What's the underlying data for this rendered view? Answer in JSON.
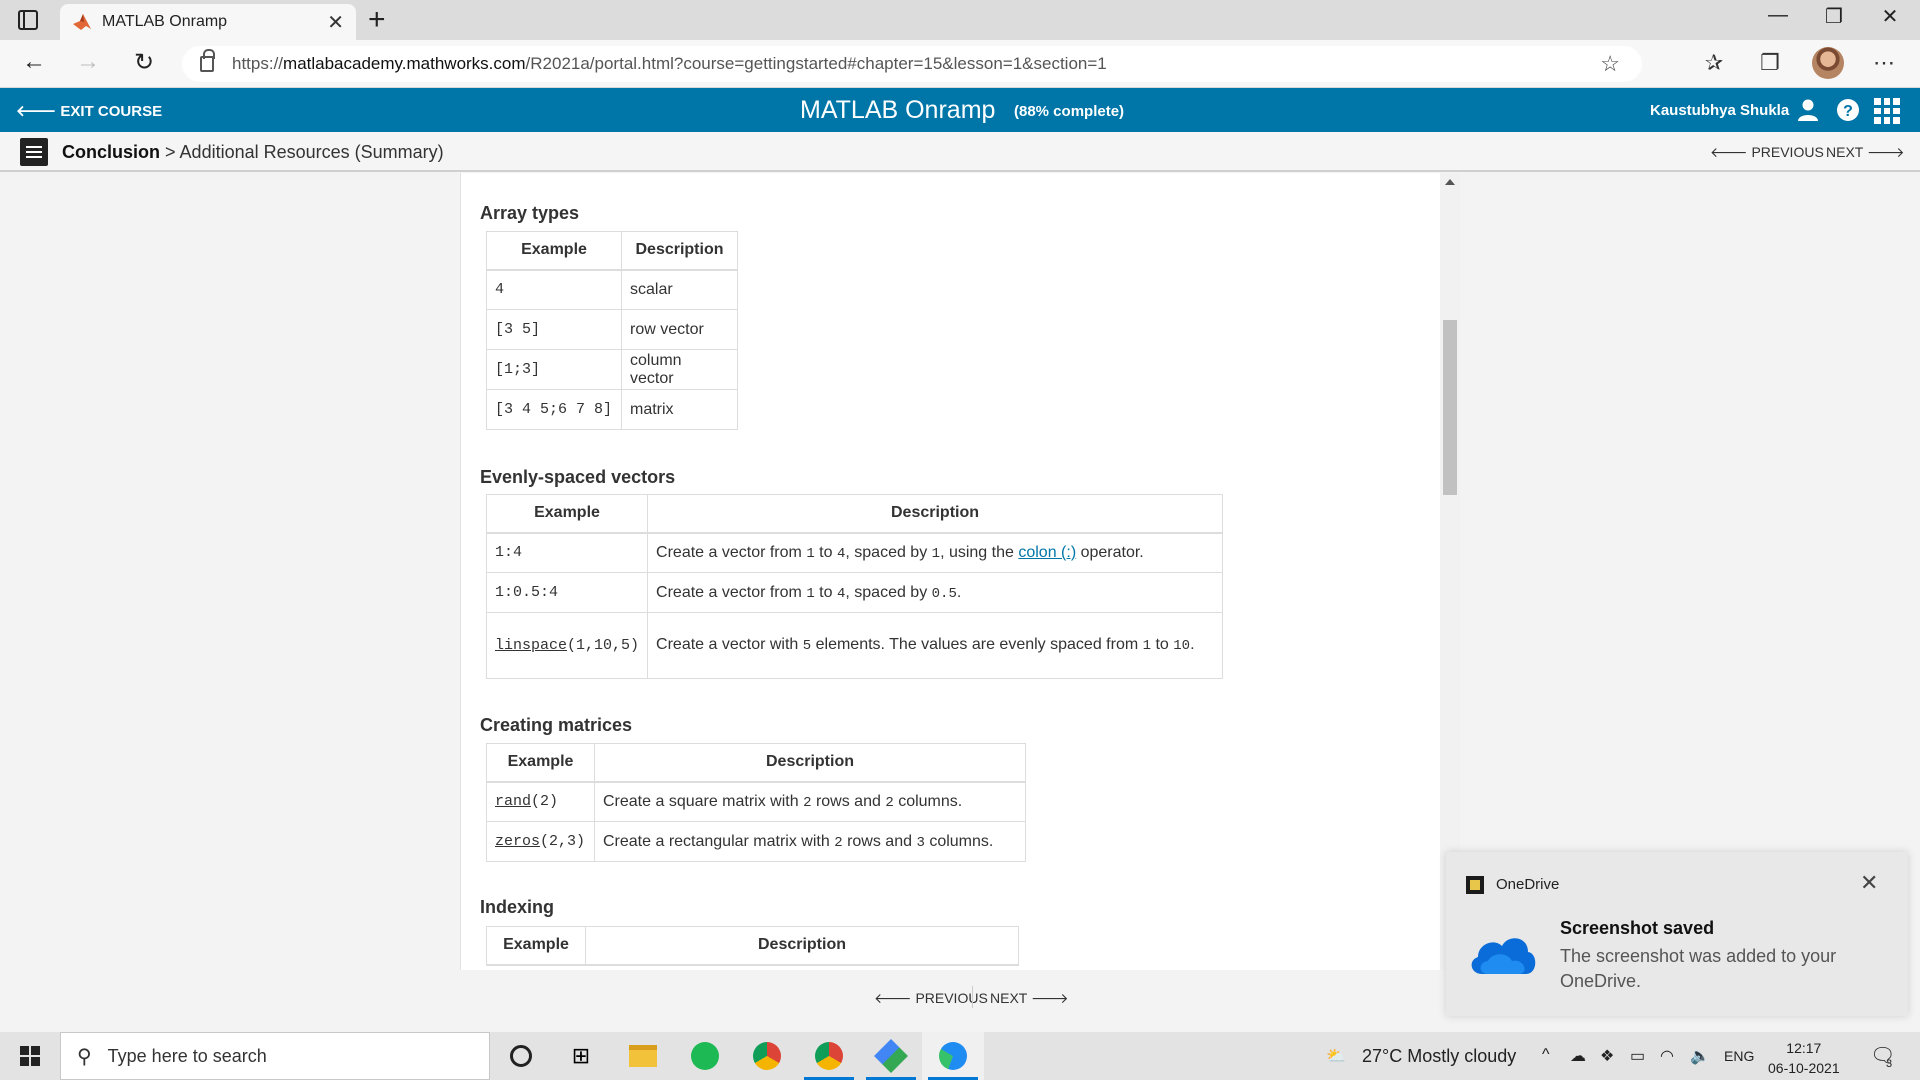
{
  "browser": {
    "tab_title": "MATLAB Onramp",
    "tab_close": "✕",
    "new_tab": "+",
    "url_prefix": "https://",
    "url_host": "matlabacademy.mathworks.com",
    "url_path": "/R2021a/portal.html?course=gettingstarted#chapter=15&lesson=1&section=1",
    "window_controls": [
      "—",
      "❐",
      "✕"
    ]
  },
  "header": {
    "exit_label": "EXIT COURSE",
    "course_title": "MATLAB Onramp",
    "progress": "(88% complete)",
    "progress_fraction": 0.88,
    "user_name": "Kaustubhya Shukla",
    "accent_color": "#0076a8"
  },
  "breadcrumb": {
    "chapter": "Conclusion",
    "separator": ">",
    "page": "Additional Resources (Summary)"
  },
  "pager": {
    "previous": "PREVIOUS",
    "next": "NEXT"
  },
  "sections": {
    "array_types": {
      "title": "Array types",
      "headers": [
        "Example",
        "Description"
      ],
      "rows": [
        [
          "4",
          "scalar"
        ],
        [
          "[3 5]",
          "row vector"
        ],
        [
          "[1;3]",
          "column vector"
        ],
        [
          "[3 4 5;6 7 8]",
          "matrix"
        ]
      ]
    },
    "evenly_spaced": {
      "title": "Evenly-spaced vectors",
      "headers": [
        "Example",
        "Description"
      ],
      "row1_example": "1:4",
      "row1_desc_a": "Create a vector from",
      "row1_n1": "1",
      "row1_to": "to",
      "row1_n2": "4",
      "row1_desc_b": ", spaced by",
      "row1_n3": "1",
      "row1_desc_c": ", using the",
      "row1_link": "colon (:)",
      "row1_desc_d": "operator.",
      "row2_example": "1:0.5:4",
      "row2_desc_a": "Create a vector from",
      "row2_n1": "1",
      "row2_to": "to",
      "row2_n2": "4",
      "row2_desc_b": ", spaced by",
      "row2_n3": "0.5",
      "row2_end": ".",
      "row3_fn": "linspace",
      "row3_args": "(1,10,5)",
      "row3_desc_a": "Create a vector with",
      "row3_n1": "5",
      "row3_desc_b": "elements. The values are evenly spaced from",
      "row3_n2": "1",
      "row3_to": "to",
      "row3_n3": "10",
      "row3_end": "."
    },
    "creating_matrices": {
      "title": "Creating matrices",
      "headers": [
        "Example",
        "Description"
      ],
      "row1_fn": "rand",
      "row1_args": "(2)",
      "row1_desc_a": "Create a square matrix with",
      "row1_n1": "2",
      "row1_desc_b": "rows and",
      "row1_n2": "2",
      "row1_desc_c": "columns.",
      "row2_fn": "zeros",
      "row2_args": "(2,3)",
      "row2_desc_a": "Create a rectangular matrix with",
      "row2_n1": "2",
      "row2_desc_b": "rows and",
      "row2_n2": "3",
      "row2_desc_c": "columns."
    },
    "indexing": {
      "title": "Indexing",
      "headers": [
        "Example",
        "Description"
      ]
    }
  },
  "toast": {
    "app": "OneDrive",
    "title": "Screenshot saved",
    "body": "The screenshot was added to your OneDrive."
  },
  "taskbar": {
    "search_placeholder": "Type here to search",
    "weather": "27°C  Mostly cloudy",
    "language": "ENG",
    "time": "12:17",
    "date": "06-10-2021",
    "notifications": "3"
  }
}
